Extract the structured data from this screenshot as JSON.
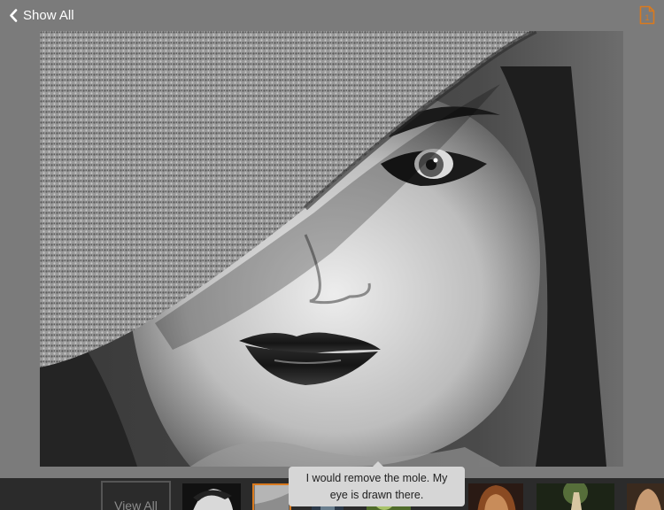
{
  "nav": {
    "back_label": "Show All",
    "back_icon": "chevron-left-icon",
    "notes_icon": "note-count-icon",
    "notes_count": "1",
    "accent_color": "#d97a1e"
  },
  "viewer": {
    "photo_description_icon": "portrait-photo"
  },
  "filmstrip": {
    "view_all_label": "View All",
    "thumbnails_count": 8,
    "active_index": 1
  },
  "tooltip": {
    "text": "I would remove the mole. My eye is drawn there."
  }
}
